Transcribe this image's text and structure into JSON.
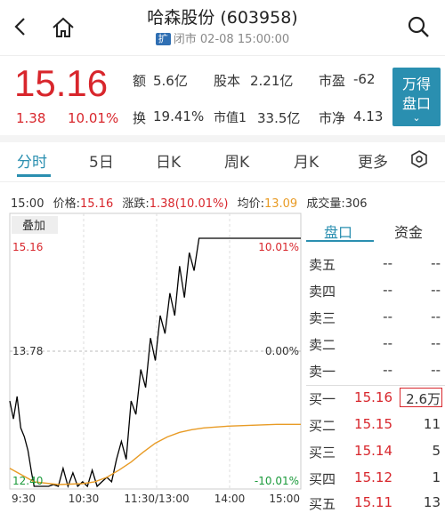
{
  "header": {
    "title": "哈森股份 (603958)",
    "badge": "扩",
    "status": "闭市 02-08 15:00:00"
  },
  "quote": {
    "price": "15.16",
    "change": "1.38",
    "change_pct": "10.01%",
    "metrics": [
      {
        "label": "额",
        "value": "5.6亿"
      },
      {
        "label": "股本",
        "value": "2.21亿"
      },
      {
        "label": "市盈",
        "value": "-62"
      },
      {
        "label": "换",
        "value": "19.41%"
      },
      {
        "label": "市值1",
        "value": "33.5亿"
      },
      {
        "label": "市净",
        "value": "4.13"
      }
    ],
    "wande_button": [
      "万得",
      "盘口"
    ]
  },
  "tabs": [
    "分时",
    "5日",
    "日K",
    "周K",
    "月K",
    "更多"
  ],
  "active_tab": "分时",
  "info": {
    "time": "15:00",
    "price_label": "价格:",
    "price": "15.16",
    "change_label": "涨跌:",
    "change": "1.38(10.01%)",
    "avg_label": "均价:",
    "avg": "13.09",
    "volume_label": "成交量:",
    "volume": "306"
  },
  "chart_data": {
    "type": "line",
    "overlay_label": "叠加",
    "y_left_labels": [
      "15.16",
      "13.78",
      "12.40"
    ],
    "y_right_labels": [
      "10.01%",
      "0.00%",
      "-10.01%"
    ],
    "x_labels": [
      "9:30",
      "10:30",
      "11:30/13:00",
      "14:00",
      "15:00"
    ],
    "ylim": [
      12.4,
      15.16
    ],
    "prev_close": 13.78,
    "series": [
      {
        "color": "#000000",
        "x": [
          0,
          3,
          6,
          9,
          12,
          15,
          18,
          20,
          24,
          28,
          32,
          36,
          40,
          44,
          48,
          52,
          56,
          60,
          64,
          68,
          72,
          76,
          80,
          84,
          88,
          92,
          96,
          100,
          104,
          108,
          112,
          116,
          120,
          124,
          128,
          132,
          136,
          140,
          144,
          148,
          152,
          156,
          160,
          240
        ],
        "y": [
          13.35,
          13.15,
          13.4,
          13.05,
          12.95,
          12.8,
          12.55,
          12.4,
          12.4,
          12.4,
          12.4,
          12.42,
          12.4,
          12.6,
          12.4,
          12.55,
          12.4,
          12.45,
          12.4,
          12.58,
          12.4,
          12.45,
          12.5,
          12.45,
          12.7,
          12.9,
          12.7,
          13.35,
          13.2,
          13.7,
          13.5,
          14.05,
          13.8,
          14.3,
          14.1,
          14.55,
          14.3,
          14.85,
          14.5,
          15.0,
          14.8,
          15.16,
          15.16,
          15.16
        ]
      },
      {
        "color": "#e89b25",
        "x": [
          0,
          20,
          40,
          60,
          70,
          80,
          90,
          100,
          110,
          120,
          130,
          140,
          150,
          160,
          170,
          180,
          200,
          220,
          240
        ],
        "y": [
          12.6,
          12.45,
          12.42,
          12.43,
          12.45,
          12.5,
          12.58,
          12.67,
          12.78,
          12.88,
          12.95,
          13.0,
          13.03,
          13.05,
          13.06,
          13.07,
          13.08,
          13.09,
          13.09
        ]
      }
    ]
  },
  "orderbook": {
    "tabs": [
      "盘口",
      "资金"
    ],
    "sell": [
      {
        "label": "卖五",
        "price": "--",
        "vol": "--"
      },
      {
        "label": "卖四",
        "price": "--",
        "vol": "--"
      },
      {
        "label": "卖三",
        "price": "--",
        "vol": "--"
      },
      {
        "label": "卖二",
        "price": "--",
        "vol": "--"
      },
      {
        "label": "卖一",
        "price": "--",
        "vol": "--"
      }
    ],
    "buy": [
      {
        "label": "买一",
        "price": "15.16",
        "vol": "2.6万"
      },
      {
        "label": "买二",
        "price": "15.15",
        "vol": "11"
      },
      {
        "label": "买三",
        "price": "15.14",
        "vol": "5"
      },
      {
        "label": "买四",
        "price": "15.12",
        "vol": "1"
      },
      {
        "label": "买五",
        "price": "15.11",
        "vol": "13"
      }
    ]
  }
}
